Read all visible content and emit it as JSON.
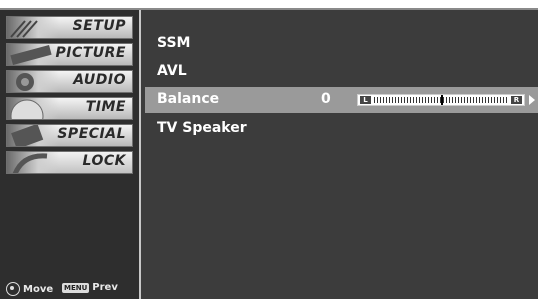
{
  "sidebar": {
    "items": [
      {
        "label": "SETUP",
        "icon": "satellite-dish-icon"
      },
      {
        "label": "PICTURE",
        "icon": "film-strip-icon"
      },
      {
        "label": "AUDIO",
        "icon": "speaker-icon"
      },
      {
        "label": "TIME",
        "icon": "clock-icon"
      },
      {
        "label": "SPECIAL",
        "icon": "special-badge-icon"
      },
      {
        "label": "LOCK",
        "icon": "lock-icon"
      }
    ],
    "legend": {
      "move": "Move",
      "menu_key": "MENU",
      "prev": "Prev"
    }
  },
  "audio_menu": {
    "items": [
      {
        "label": "SSM"
      },
      {
        "label": "AVL"
      },
      {
        "label": "Balance",
        "value": "0",
        "selected": true,
        "slider": {
          "left_label": "L",
          "right_label": "R",
          "position": 0.5
        }
      },
      {
        "label": "TV Speaker"
      }
    ]
  },
  "colors": {
    "sidebar_bg": "#2e2e2e",
    "main_bg": "#3c3c3c",
    "selected_row": "#9a9a9a",
    "text": "#ffffff"
  }
}
